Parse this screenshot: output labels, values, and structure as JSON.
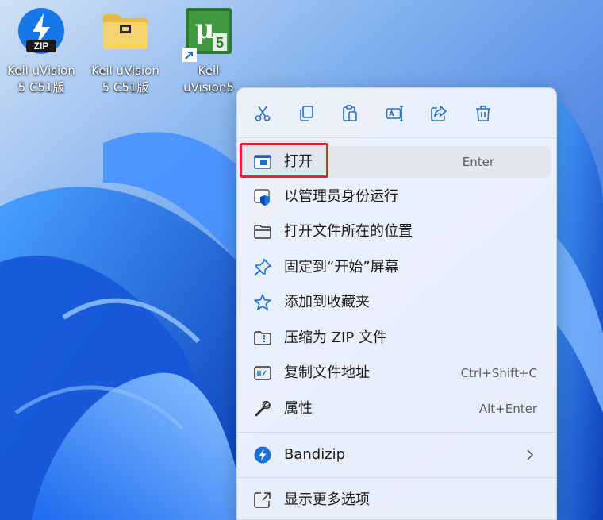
{
  "desktop": {
    "icons": [
      {
        "label": "Keil uVision\n5 C51版",
        "badge_text": "ZIP"
      },
      {
        "label": "Keil uVision\n5 C51版"
      },
      {
        "label": "Keil\nuVision5",
        "logo_text": "μ",
        "logo_sub": "5"
      }
    ]
  },
  "toolbar": {
    "buttons": [
      "cut-icon",
      "copy-icon",
      "paste-icon",
      "rename-icon",
      "share-icon",
      "delete-icon"
    ]
  },
  "menu": {
    "items": [
      {
        "label": "打开",
        "shortcut": "Enter",
        "icon": "window-icon"
      },
      {
        "label": "以管理员身份运行",
        "shortcut": "",
        "icon": "shield-window-icon"
      },
      {
        "label": "打开文件所在的位置",
        "shortcut": "",
        "icon": "folder-icon"
      },
      {
        "label": "固定到“开始”屏幕",
        "shortcut": "",
        "icon": "pin-icon"
      },
      {
        "label": "添加到收藏夹",
        "shortcut": "",
        "icon": "star-icon"
      },
      {
        "label": "压缩为 ZIP 文件",
        "shortcut": "",
        "icon": "zip-folder-icon"
      },
      {
        "label": "复制文件地址",
        "shortcut": "Ctrl+Shift+C",
        "icon": "copy-path-icon"
      },
      {
        "label": "属性",
        "shortcut": "Alt+Enter",
        "icon": "wrench-icon"
      }
    ],
    "bandizip": {
      "label": "Bandizip",
      "icon": "bandizip-icon"
    },
    "more": {
      "label": "显示更多选项",
      "icon": "more-options-icon"
    }
  },
  "colors": {
    "accent": "#0067c0",
    "highlight_border": "#e3262b",
    "menu_bg": "#eef3fb"
  }
}
